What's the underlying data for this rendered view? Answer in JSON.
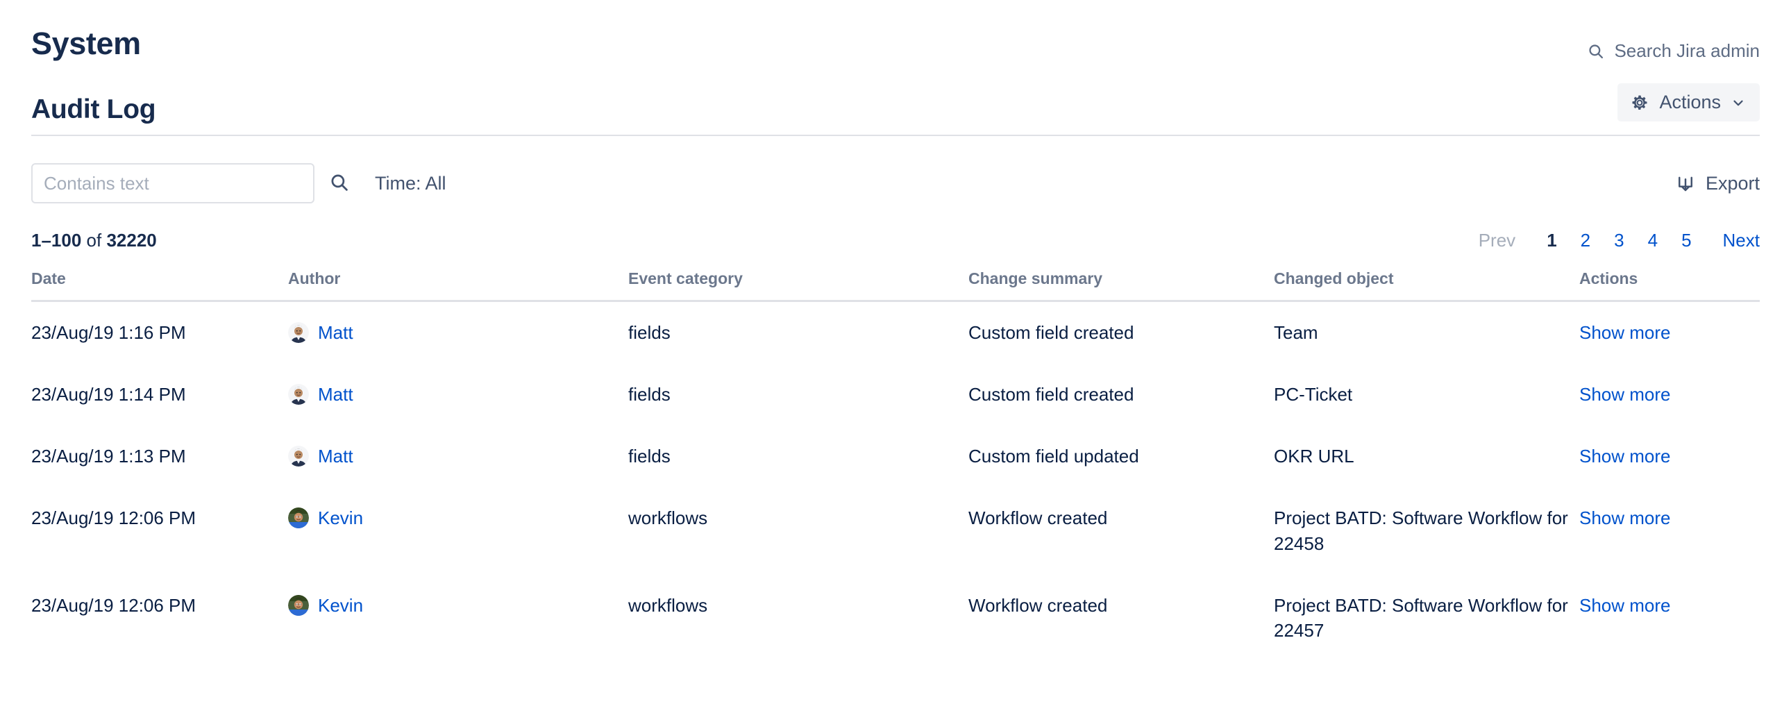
{
  "header": {
    "title": "System",
    "admin_search_label": "Search Jira admin",
    "admin_search_icon": "search-icon"
  },
  "section": {
    "title": "Audit Log",
    "actions_label": "Actions",
    "actions_icon": "gear-icon",
    "actions_chevron_icon": "chevron-down-icon"
  },
  "filters": {
    "text_value": "",
    "text_placeholder": "Contains text",
    "search_icon": "search-icon",
    "time_label": "Time: All",
    "export_label": "Export",
    "export_icon": "export-download-icon"
  },
  "results": {
    "range": "1–100",
    "of_label": "of",
    "total": "32220"
  },
  "pagination": {
    "prev_label": "Prev",
    "next_label": "Next",
    "pages": [
      "1",
      "2",
      "3",
      "4",
      "5"
    ],
    "current": "1"
  },
  "table": {
    "columns": [
      "Date",
      "Author",
      "Event category",
      "Change summary",
      "Changed object",
      "Actions"
    ],
    "rows": [
      {
        "date": "23/Aug/19 1:16 PM",
        "author": "Matt",
        "avatar": "avatar-matt",
        "category": "fields",
        "summary": "Custom field created",
        "object": "Team",
        "action": "Show more"
      },
      {
        "date": "23/Aug/19 1:14 PM",
        "author": "Matt",
        "avatar": "avatar-matt",
        "category": "fields",
        "summary": "Custom field created",
        "object": "PC-Ticket",
        "action": "Show more"
      },
      {
        "date": "23/Aug/19 1:13 PM",
        "author": "Matt",
        "avatar": "avatar-matt",
        "category": "fields",
        "summary": "Custom field updated",
        "object": "OKR URL",
        "action": "Show more"
      },
      {
        "date": "23/Aug/19 12:06 PM",
        "author": "Kevin",
        "avatar": "avatar-kevin",
        "category": "workflows",
        "summary": "Workflow created",
        "object": "Project BATD: Software Workflow for 22458",
        "action": "Show more"
      },
      {
        "date": "23/Aug/19 12:06 PM",
        "author": "Kevin",
        "avatar": "avatar-kevin",
        "category": "workflows",
        "summary": "Workflow created",
        "object": "Project BATD: Software Workflow for 22457",
        "action": "Show more"
      }
    ]
  },
  "colors": {
    "link": "#0052CC",
    "heading": "#172B4D",
    "muted": "#6B778C",
    "border": "#DFE1E6",
    "button_bg": "#F4F5F7"
  }
}
